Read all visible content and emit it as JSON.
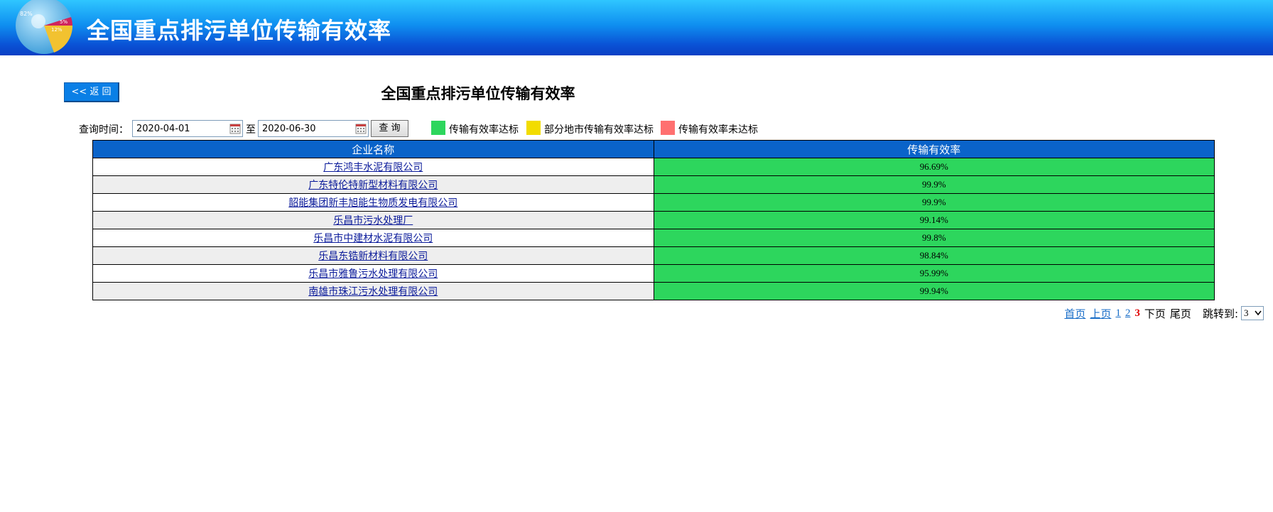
{
  "header": {
    "title": "全国重点排污单位传输有效率",
    "logo_labels": [
      "82%",
      "5%",
      "12%"
    ]
  },
  "toolbar": {
    "back_label": "<< 返 回",
    "page_title": "全国重点排污单位传输有效率"
  },
  "query": {
    "label": "查询时间：",
    "start_date": "2020-04-01",
    "to_label": "至",
    "end_date": "2020-06-30",
    "search_label": "查 询"
  },
  "legend": [
    {
      "label": "传输有效率达标",
      "color": "#2dd65d"
    },
    {
      "label": "部分地市传输有效率达标",
      "color": "#f2dc00"
    },
    {
      "label": "传输有效率未达标",
      "color": "#ff7070"
    }
  ],
  "table": {
    "headers": [
      "企业名称",
      "传输有效率"
    ],
    "rows": [
      {
        "name": "广东鸿丰水泥有限公司",
        "rate": "96.69%"
      },
      {
        "name": "广东特伦特新型材料有限公司",
        "rate": "99.9%"
      },
      {
        "name": "韶能集团新丰旭能生物质发电有限公司",
        "rate": "99.9%"
      },
      {
        "name": "乐昌市污水处理厂",
        "rate": "99.14%"
      },
      {
        "name": "乐昌市中建材水泥有限公司",
        "rate": "99.8%"
      },
      {
        "name": "乐昌东锆新材料有限公司",
        "rate": "98.84%"
      },
      {
        "name": "乐昌市雅鲁污水处理有限公司",
        "rate": "95.99%"
      },
      {
        "name": "南雄市珠江污水处理有限公司",
        "rate": "99.94%"
      }
    ]
  },
  "pager": {
    "first": "首页",
    "prev": "上页",
    "pages": [
      "1",
      "2"
    ],
    "current": "3",
    "next": "下页",
    "last": "尾页",
    "jump_label": "跳转到:",
    "selected_page": "3"
  }
}
